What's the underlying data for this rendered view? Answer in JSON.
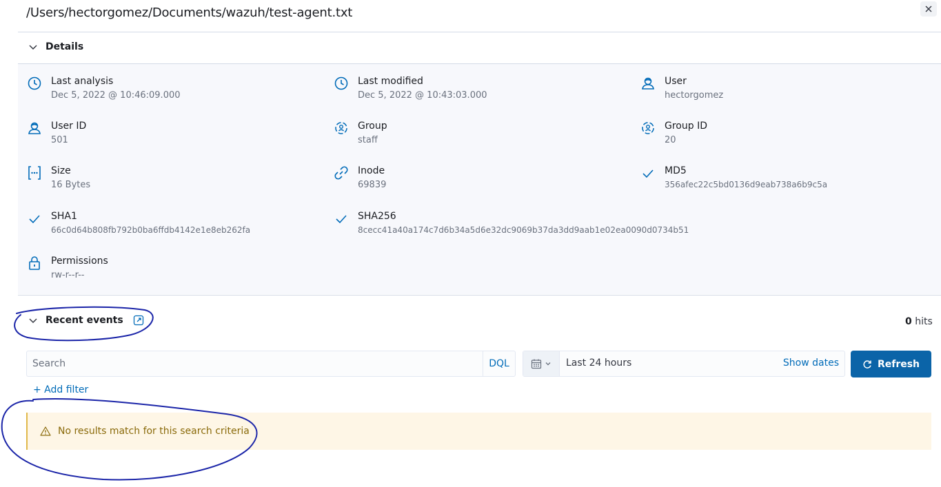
{
  "title": "/Users/hectorgomez/Documents/wazuh/test-agent.txt",
  "details": {
    "header": "Details",
    "items": [
      {
        "label": "Last analysis",
        "value": "Dec 5, 2022 @ 10:46:09.000",
        "icon": "clock-icon"
      },
      {
        "label": "Last modified",
        "value": "Dec 5, 2022 @ 10:43:03.000",
        "icon": "clock-icon"
      },
      {
        "label": "User",
        "value": "hectorgomez",
        "icon": "user-icon"
      },
      {
        "label": "User ID",
        "value": "501",
        "icon": "user-icon"
      },
      {
        "label": "Group",
        "value": "staff",
        "icon": "group-icon"
      },
      {
        "label": "Group ID",
        "value": "20",
        "icon": "group-icon"
      },
      {
        "label": "Size",
        "value": "16 Bytes",
        "icon": "size-icon"
      },
      {
        "label": "Inode",
        "value": "69839",
        "icon": "link-icon"
      },
      {
        "label": "MD5",
        "value": "356afec22c5bd0136d9eab738a6b9c5a",
        "icon": "check-icon"
      },
      {
        "label": "SHA1",
        "value": "66c0d64b808fb792b0ba6ffdb4142e1e8eb262fa",
        "icon": "check-icon"
      },
      {
        "label": "SHA256",
        "value": "8cecc41a40a174c7d6b34a5d6e32dc9069b37da3dd9aab1e02ea0090d0734b51",
        "icon": "check-icon"
      },
      {
        "label": "Permissions",
        "value": "rw-r--r--",
        "icon": "lock-icon"
      }
    ]
  },
  "recent": {
    "header": "Recent events",
    "hits_count": "0",
    "hits_label": "hits"
  },
  "search": {
    "placeholder": "Search",
    "dql": "DQL"
  },
  "date": {
    "range": "Last 24 hours",
    "show_dates": "Show dates"
  },
  "refresh_label": "Refresh",
  "add_filter": "+ Add filter",
  "callout": "No results match for this search criteria",
  "colors": {
    "accent": "#006bb8",
    "button": "#0b64a8",
    "warning_bg": "#fef6e6",
    "annotation": "#1a24a8"
  }
}
